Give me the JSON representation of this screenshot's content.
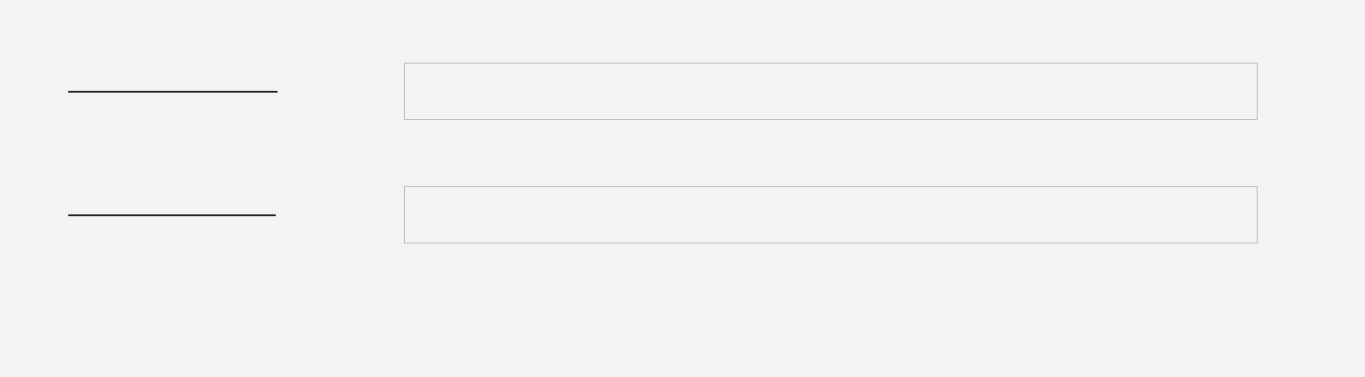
{
  "colors": {
    "background": "#f2f3f2",
    "field_border": "#bbbcbb",
    "label_rule": "#222222"
  },
  "form": {
    "fields": [
      {
        "label": "",
        "value": "",
        "placeholder": ""
      },
      {
        "label": "",
        "value": "",
        "placeholder": ""
      }
    ]
  }
}
